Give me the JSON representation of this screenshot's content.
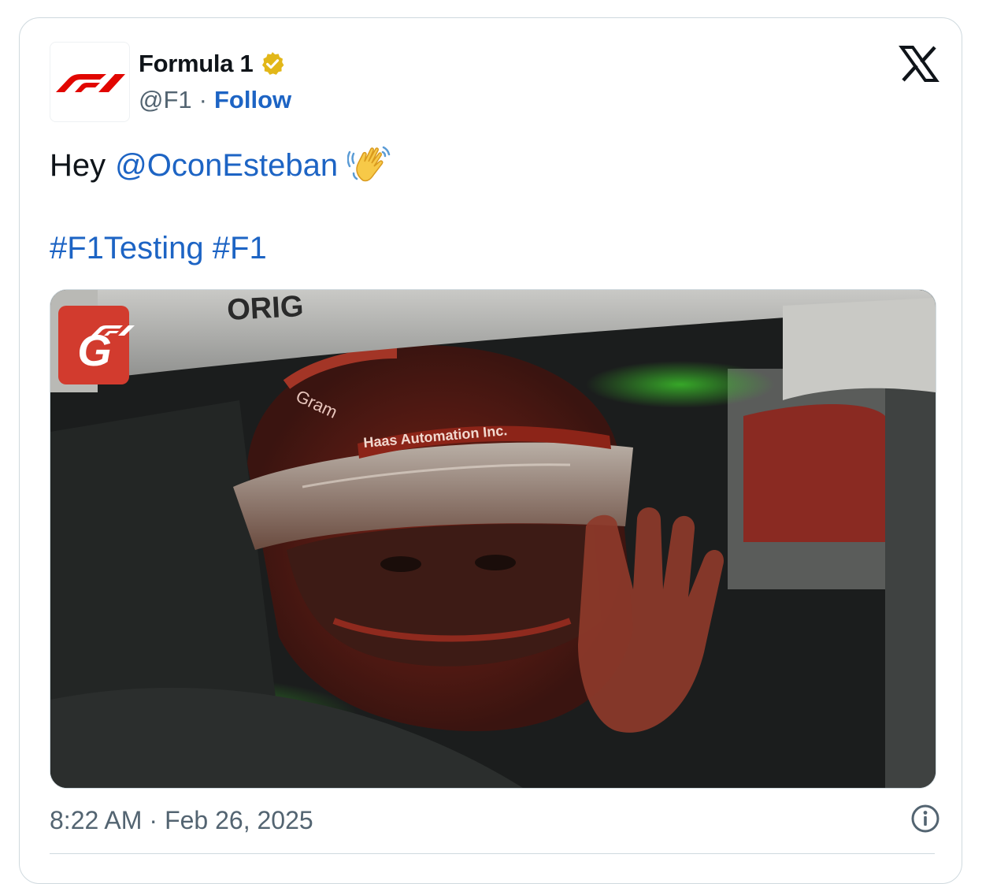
{
  "author": {
    "name": "Formula 1",
    "handle": "@F1",
    "separator": "·",
    "follow_label": "Follow",
    "avatar_icon": "f1-logo-icon",
    "verified_icon": "gold-verified-badge-icon"
  },
  "platform_icon": "x-logo-icon",
  "tweet": {
    "prefix": "Hey",
    "mention": "@OconEsteban",
    "emoji_icon": "waving-hand-icon",
    "hashtags": [
      "#F1Testing",
      "#F1"
    ]
  },
  "media": {
    "overlay_icon": "f1-logo-icon",
    "helmet_brand_text": "Haas Automation Inc.",
    "helmet_sponsor_text": "Gram",
    "halo_text": "ORIG"
  },
  "meta": {
    "time": "8:22 AM",
    "separator": "·",
    "date": "Feb 26, 2025",
    "info_icon": "info-icon"
  },
  "colors": {
    "link": "#1d64c4",
    "f1_red": "#e10600",
    "muted": "#536471",
    "verified_gold": "#e2b719"
  }
}
